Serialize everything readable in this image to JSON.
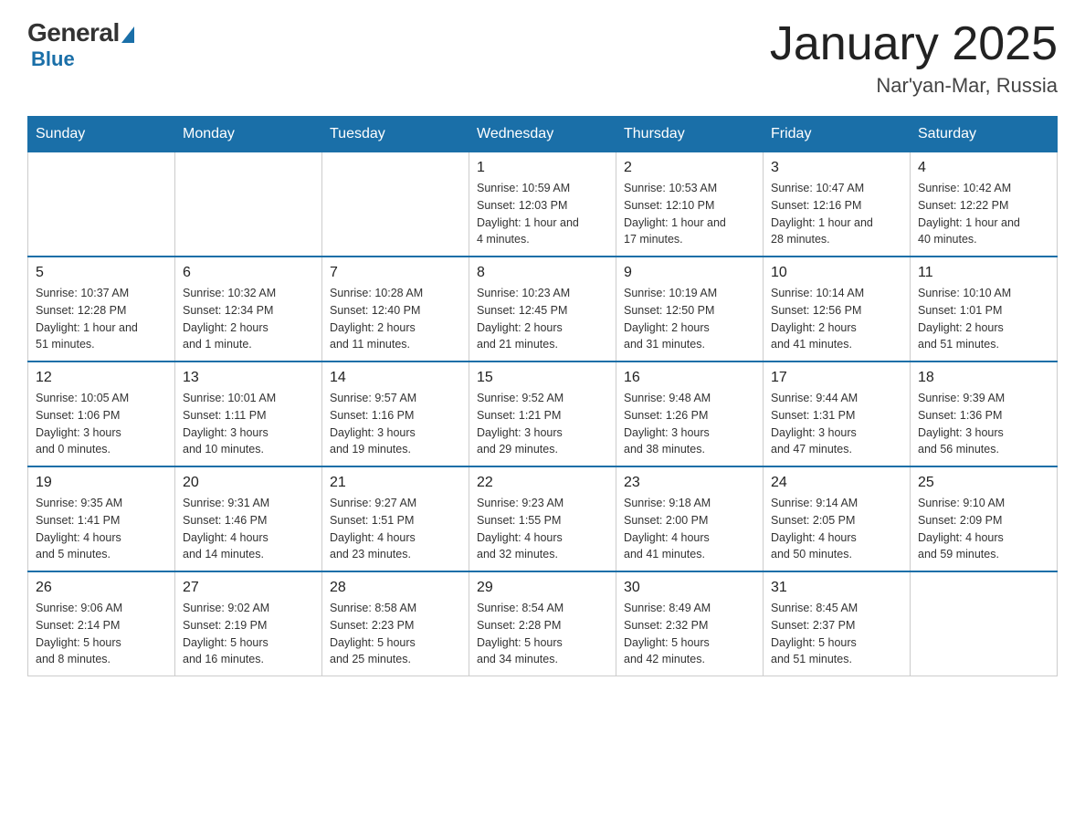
{
  "header": {
    "logo_general": "General",
    "logo_blue": "Blue",
    "month_title": "January 2025",
    "location": "Nar'yan-Mar, Russia"
  },
  "weekdays": [
    "Sunday",
    "Monday",
    "Tuesday",
    "Wednesday",
    "Thursday",
    "Friday",
    "Saturday"
  ],
  "weeks": [
    [
      {
        "day": "",
        "info": ""
      },
      {
        "day": "",
        "info": ""
      },
      {
        "day": "",
        "info": ""
      },
      {
        "day": "1",
        "info": "Sunrise: 10:59 AM\nSunset: 12:03 PM\nDaylight: 1 hour and\n4 minutes."
      },
      {
        "day": "2",
        "info": "Sunrise: 10:53 AM\nSunset: 12:10 PM\nDaylight: 1 hour and\n17 minutes."
      },
      {
        "day": "3",
        "info": "Sunrise: 10:47 AM\nSunset: 12:16 PM\nDaylight: 1 hour and\n28 minutes."
      },
      {
        "day": "4",
        "info": "Sunrise: 10:42 AM\nSunset: 12:22 PM\nDaylight: 1 hour and\n40 minutes."
      }
    ],
    [
      {
        "day": "5",
        "info": "Sunrise: 10:37 AM\nSunset: 12:28 PM\nDaylight: 1 hour and\n51 minutes."
      },
      {
        "day": "6",
        "info": "Sunrise: 10:32 AM\nSunset: 12:34 PM\nDaylight: 2 hours\nand 1 minute."
      },
      {
        "day": "7",
        "info": "Sunrise: 10:28 AM\nSunset: 12:40 PM\nDaylight: 2 hours\nand 11 minutes."
      },
      {
        "day": "8",
        "info": "Sunrise: 10:23 AM\nSunset: 12:45 PM\nDaylight: 2 hours\nand 21 minutes."
      },
      {
        "day": "9",
        "info": "Sunrise: 10:19 AM\nSunset: 12:50 PM\nDaylight: 2 hours\nand 31 minutes."
      },
      {
        "day": "10",
        "info": "Sunrise: 10:14 AM\nSunset: 12:56 PM\nDaylight: 2 hours\nand 41 minutes."
      },
      {
        "day": "11",
        "info": "Sunrise: 10:10 AM\nSunset: 1:01 PM\nDaylight: 2 hours\nand 51 minutes."
      }
    ],
    [
      {
        "day": "12",
        "info": "Sunrise: 10:05 AM\nSunset: 1:06 PM\nDaylight: 3 hours\nand 0 minutes."
      },
      {
        "day": "13",
        "info": "Sunrise: 10:01 AM\nSunset: 1:11 PM\nDaylight: 3 hours\nand 10 minutes."
      },
      {
        "day": "14",
        "info": "Sunrise: 9:57 AM\nSunset: 1:16 PM\nDaylight: 3 hours\nand 19 minutes."
      },
      {
        "day": "15",
        "info": "Sunrise: 9:52 AM\nSunset: 1:21 PM\nDaylight: 3 hours\nand 29 minutes."
      },
      {
        "day": "16",
        "info": "Sunrise: 9:48 AM\nSunset: 1:26 PM\nDaylight: 3 hours\nand 38 minutes."
      },
      {
        "day": "17",
        "info": "Sunrise: 9:44 AM\nSunset: 1:31 PM\nDaylight: 3 hours\nand 47 minutes."
      },
      {
        "day": "18",
        "info": "Sunrise: 9:39 AM\nSunset: 1:36 PM\nDaylight: 3 hours\nand 56 minutes."
      }
    ],
    [
      {
        "day": "19",
        "info": "Sunrise: 9:35 AM\nSunset: 1:41 PM\nDaylight: 4 hours\nand 5 minutes."
      },
      {
        "day": "20",
        "info": "Sunrise: 9:31 AM\nSunset: 1:46 PM\nDaylight: 4 hours\nand 14 minutes."
      },
      {
        "day": "21",
        "info": "Sunrise: 9:27 AM\nSunset: 1:51 PM\nDaylight: 4 hours\nand 23 minutes."
      },
      {
        "day": "22",
        "info": "Sunrise: 9:23 AM\nSunset: 1:55 PM\nDaylight: 4 hours\nand 32 minutes."
      },
      {
        "day": "23",
        "info": "Sunrise: 9:18 AM\nSunset: 2:00 PM\nDaylight: 4 hours\nand 41 minutes."
      },
      {
        "day": "24",
        "info": "Sunrise: 9:14 AM\nSunset: 2:05 PM\nDaylight: 4 hours\nand 50 minutes."
      },
      {
        "day": "25",
        "info": "Sunrise: 9:10 AM\nSunset: 2:09 PM\nDaylight: 4 hours\nand 59 minutes."
      }
    ],
    [
      {
        "day": "26",
        "info": "Sunrise: 9:06 AM\nSunset: 2:14 PM\nDaylight: 5 hours\nand 8 minutes."
      },
      {
        "day": "27",
        "info": "Sunrise: 9:02 AM\nSunset: 2:19 PM\nDaylight: 5 hours\nand 16 minutes."
      },
      {
        "day": "28",
        "info": "Sunrise: 8:58 AM\nSunset: 2:23 PM\nDaylight: 5 hours\nand 25 minutes."
      },
      {
        "day": "29",
        "info": "Sunrise: 8:54 AM\nSunset: 2:28 PM\nDaylight: 5 hours\nand 34 minutes."
      },
      {
        "day": "30",
        "info": "Sunrise: 8:49 AM\nSunset: 2:32 PM\nDaylight: 5 hours\nand 42 minutes."
      },
      {
        "day": "31",
        "info": "Sunrise: 8:45 AM\nSunset: 2:37 PM\nDaylight: 5 hours\nand 51 minutes."
      },
      {
        "day": "",
        "info": ""
      }
    ]
  ]
}
